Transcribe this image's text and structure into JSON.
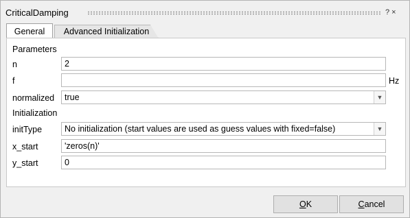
{
  "window": {
    "title": "CriticalDamping",
    "help_icon": "?",
    "close_icon": "×"
  },
  "tabs": [
    {
      "label": "General",
      "selected": true
    },
    {
      "label": "Advanced Initialization",
      "selected": false
    }
  ],
  "parameters": {
    "heading": "Parameters",
    "n": {
      "label": "n",
      "value": "2"
    },
    "f": {
      "label": "f",
      "value": "",
      "unit": "Hz"
    },
    "normalized": {
      "label": "normalized",
      "value": "true"
    }
  },
  "initialization": {
    "heading": "Initialization",
    "initType": {
      "label": "initType",
      "value": "No initialization (start values are used as guess values with fixed=false)"
    },
    "x_start": {
      "label": "x_start",
      "value": "'zeros(n)'"
    },
    "y_start": {
      "label": "y_start",
      "value": "0"
    }
  },
  "buttons": {
    "ok_first": "O",
    "ok_rest": "K",
    "cancel_first": "C",
    "cancel_rest": "ancel"
  }
}
